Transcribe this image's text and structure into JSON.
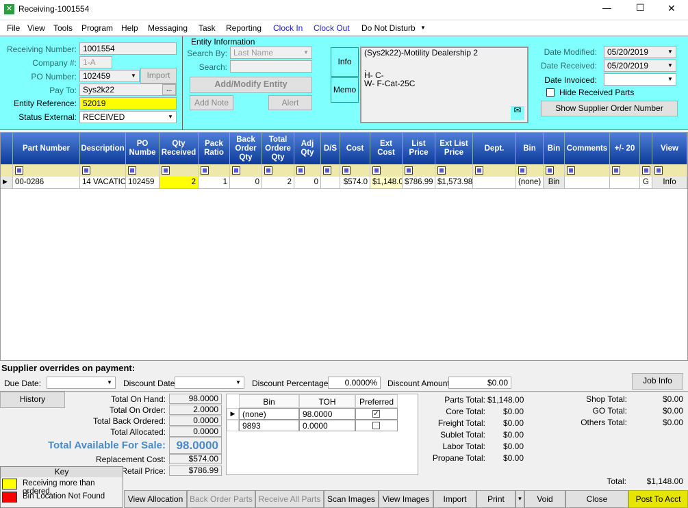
{
  "window": {
    "title": "Receiving-1001554",
    "minimize": "—",
    "maximize": "☐",
    "close": "✕"
  },
  "menu": [
    "File",
    "View",
    "Tools",
    "Program",
    "Help",
    "Messaging",
    "Task",
    "Reporting",
    "Clock In",
    "Clock Out",
    "Do Not Disturb"
  ],
  "header": {
    "receiving_number_label": "Receiving Number:",
    "receiving_number": "1001554",
    "company_label": "Company #:",
    "company": "1-A",
    "po_label": "PO Number:",
    "po": "102459",
    "import": "Import",
    "pay_to_label": "Pay To:",
    "pay_to": "Sys2k22",
    "ellipsis": "...",
    "entity_ref_label": "Entity Reference:",
    "entity_ref": "52019",
    "status_label": "Status External:",
    "status": "RECEIVED"
  },
  "entity": {
    "title": "Entity Information",
    "search_by_label": "Search By:",
    "search_by": "Last Name",
    "search_label": "Search:",
    "search": "",
    "add_modify": "Add/Modify Entity",
    "add_note": "Add Note",
    "alert": "Alert",
    "tab_info": "Info",
    "tab_memo": "Memo",
    "info_lines": [
      "(Sys2k22)-Motility Dealership 2",
      "",
      ".",
      "H- C-",
      "W- F-Cat-25C"
    ]
  },
  "dates": {
    "modified_label": "Date Modified:",
    "modified": "05/20/2019",
    "received_label": "Date Received:",
    "received": "05/20/2019",
    "invoiced_label": "Date Invoiced:",
    "invoiced": "",
    "hide_received": "Hide Received Parts",
    "hide_received_checked": false,
    "show_supplier": "Show Supplier Order Number"
  },
  "grid": {
    "columns": [
      "Part Number",
      "Description",
      "PO Numbe",
      "Qty Received",
      "Pack Ratio",
      "Back Order Qty",
      "Total Ordere Qty",
      "Adj Qty",
      "D/S",
      "Cost",
      "Ext Cost",
      "List Price",
      "Ext List Price",
      "Dept.",
      "Bin",
      "Bin",
      "Comments",
      "+/- 20",
      "",
      "View"
    ],
    "rows": [
      [
        "00-0286",
        "14 VACATIO",
        "102459",
        "2",
        "1",
        "0",
        "2",
        "0",
        "",
        "$574.0",
        "$1,148.0",
        "$786.99",
        "$1,573.98",
        "",
        "(none)",
        "Bin",
        "",
        "",
        "G",
        "Info"
      ]
    ]
  },
  "supplier": {
    "title": "Supplier overrides on payment:",
    "due_date_label": "Due Date:",
    "due_date": "",
    "discount_date_label": "Discount Date:",
    "discount_date": "",
    "discount_pct_label": "Discount Percentage:",
    "discount_pct": "0.0000%",
    "discount_amt_label": "Discount Amount:",
    "discount_amt": "$0.00",
    "job_info": "Job Info"
  },
  "stock": {
    "history": "History",
    "items": [
      [
        "Total On Hand:",
        "98.0000"
      ],
      [
        "Total On Order:",
        "2.0000"
      ],
      [
        "Total Back Ordered:",
        "0.0000"
      ],
      [
        "Total Allocated:",
        "0.0000"
      ]
    ],
    "available_label": "Total Available For Sale:",
    "available": "98.0000",
    "replacement_label": "Replacement Cost:",
    "replacement": "$574.00",
    "retail_label": "Retail Price:",
    "retail": "$786.99"
  },
  "bins": {
    "headers": [
      "Bin",
      "TOH",
      "Preferred"
    ],
    "rows": [
      [
        "(none)",
        "98.0000",
        true
      ],
      [
        "9893",
        "0.0000",
        false
      ]
    ]
  },
  "key": {
    "title": "Key",
    "items": [
      {
        "color": "#ffff00",
        "label": "Receiving more than ordered."
      },
      {
        "color": "#ff0000",
        "label": "Bin Location Not Found"
      }
    ]
  },
  "totals": {
    "left": [
      [
        "Parts Total:",
        "$1,148.00"
      ],
      [
        "Core Total:",
        "$0.00"
      ],
      [
        "Freight Total:",
        "$0.00"
      ],
      [
        "Sublet Total:",
        "$0.00"
      ],
      [
        "Labor Total:",
        "$0.00"
      ],
      [
        "Propane Total:",
        "$0.00"
      ]
    ],
    "right": [
      [
        "Shop Total:",
        "$0.00"
      ],
      [
        "GO Total:",
        "$0.00"
      ],
      [
        "Others Total:",
        "$0.00"
      ]
    ],
    "total_label": "Total:",
    "total": "$1,148.00"
  },
  "buttons": [
    "View Allocation",
    "Back Order Parts",
    "Receive All Parts",
    "Scan Images",
    "View Images",
    "Import",
    "Print",
    "Void",
    "Close",
    "Post To Acct"
  ],
  "colors": {
    "form_bg": "#80ffff",
    "header_blue": "#1a4aa8",
    "highlight": "#ffff00",
    "post_button": "#e5e500"
  }
}
